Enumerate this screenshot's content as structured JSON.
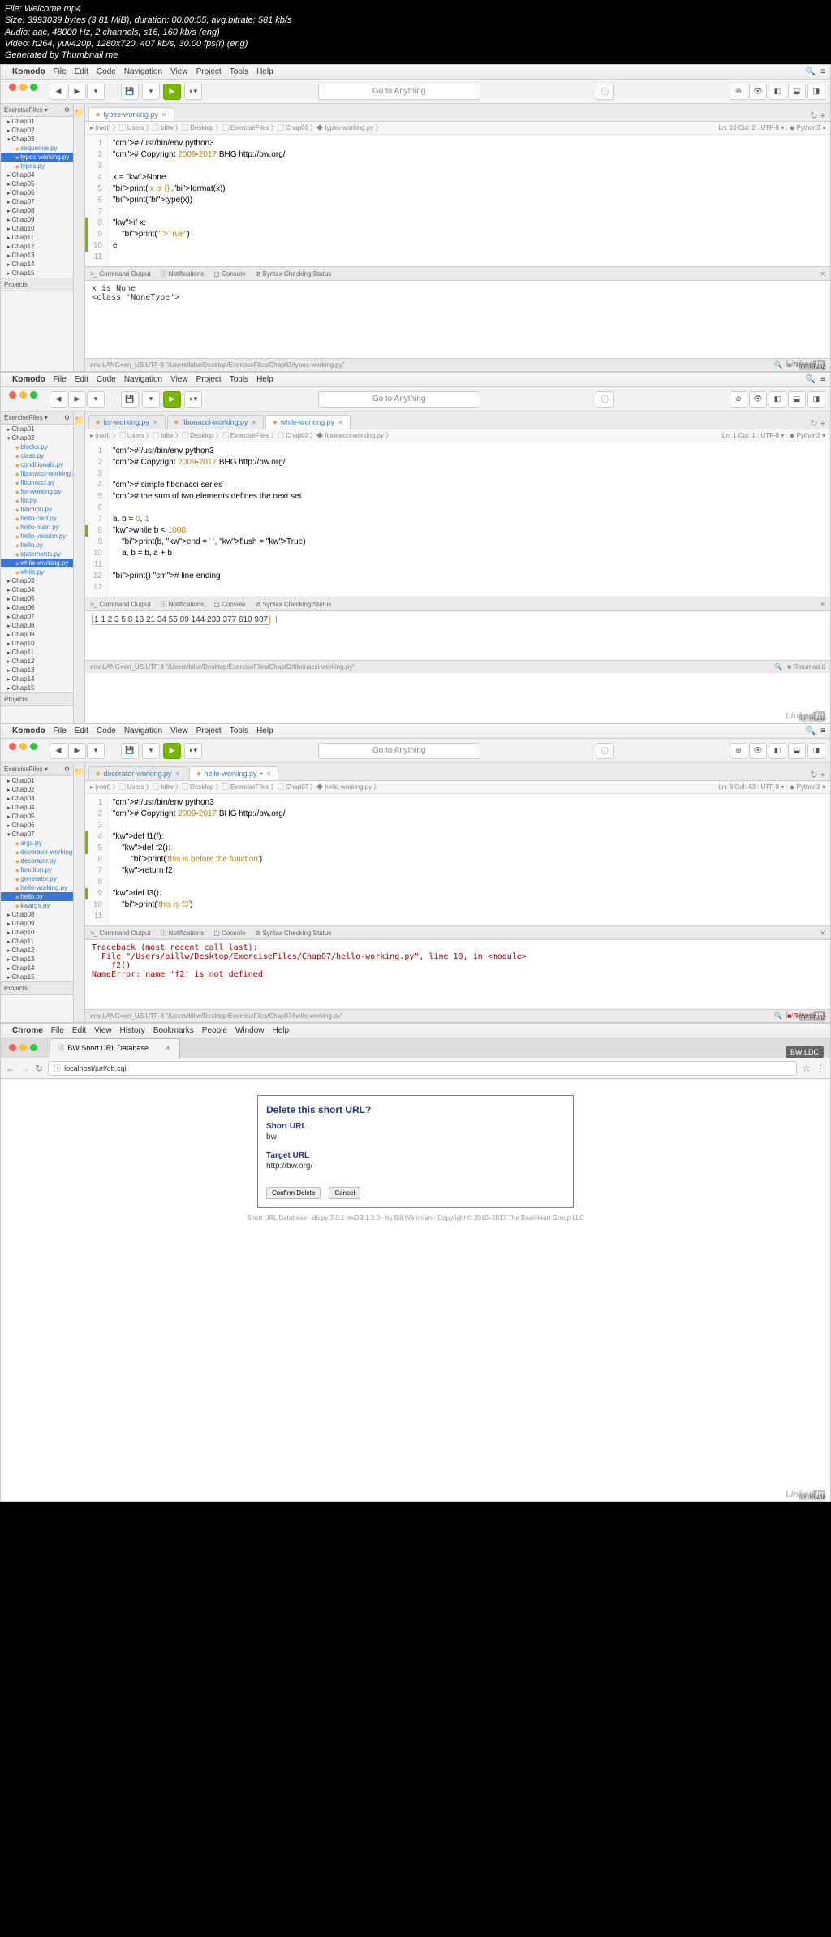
{
  "info_header": {
    "file": "File: Welcome.mp4",
    "size": "Size: 3993039 bytes (3.81 MiB), duration: 00:00:55, avg.bitrate: 581 kb/s",
    "audio": "Audio: aac, 48000 Hz, 2 channels, s16, 160 kb/s (eng)",
    "video": "Video: h264, yuv420p, 1280x720, 407 kb/s, 30.00 fps(r) (eng)",
    "generated": "Generated by Thumbnail me"
  },
  "menubar": {
    "app": "Komodo",
    "items": [
      "File",
      "Edit",
      "Code",
      "Navigation",
      "View",
      "Project",
      "Tools",
      "Help"
    ]
  },
  "goto_placeholder": "Go to Anything",
  "shot1": {
    "sidebar_header": "ExerciseFiles ▾",
    "tree": [
      {
        "t": "folder",
        "l": "Chap01"
      },
      {
        "t": "folder",
        "l": "Chap02"
      },
      {
        "t": "folder open",
        "l": "Chap03"
      },
      {
        "t": "file py",
        "l": "sequence.py"
      },
      {
        "t": "file py selected",
        "l": "types-working.py"
      },
      {
        "t": "file py",
        "l": "types.py"
      },
      {
        "t": "folder",
        "l": "Chap04"
      },
      {
        "t": "folder",
        "l": "Chap05"
      },
      {
        "t": "folder",
        "l": "Chap06"
      },
      {
        "t": "folder",
        "l": "Chap07"
      },
      {
        "t": "folder",
        "l": "Chap08"
      },
      {
        "t": "folder",
        "l": "Chap09"
      },
      {
        "t": "folder",
        "l": "Chap10"
      },
      {
        "t": "folder",
        "l": "Chap11"
      },
      {
        "t": "folder",
        "l": "Chap12"
      },
      {
        "t": "folder",
        "l": "Chap13"
      },
      {
        "t": "folder",
        "l": "Chap14"
      },
      {
        "t": "folder",
        "l": "Chap15"
      }
    ],
    "projects": "Projects",
    "tabs": [
      {
        "label": "types-working.py",
        "active": true
      }
    ],
    "breadcrumb": "▸ (root) 〉▢ Users 〉▢ billw 〉▢ Desktop 〉▢ ExerciseFiles 〉▢ Chap03 〉◆ types-working.py 〉",
    "status_right": "Ln: 10  Col: 2 : UTF-8 ▾ : ◆ Python3 ▾",
    "code_lines": [
      "#!/usr/bin/env python3",
      "# Copyright 2009-2017 BHG http://bw.org/",
      "",
      "x = None",
      "print('x is {}'.format(x))",
      "print(type(x))",
      "",
      "if x:",
      "    print(\"True\")",
      "e",
      ""
    ],
    "panel_tabs": [
      ">_ Command Output",
      "ⓘ Notifications",
      "▢ Console",
      "⊘ Syntax Checking Status"
    ],
    "output": "x is None\n<class 'NoneType'>",
    "statusbar_left": "env LANG=en_US.UTF-8 \"/Users/billw/Desktop/ExerciseFiles/Chap03/types-working.py\"",
    "statusbar_right": "■ Returned 0",
    "timestamp": "00:00:05"
  },
  "shot2": {
    "tree": [
      {
        "t": "folder",
        "l": "Chap01"
      },
      {
        "t": "folder open",
        "l": "Chap02"
      },
      {
        "t": "file py",
        "l": "blocks.py"
      },
      {
        "t": "file py",
        "l": "class.py"
      },
      {
        "t": "file py",
        "l": "conditionals.py"
      },
      {
        "t": "file py",
        "l": "fibonacci-working.py"
      },
      {
        "t": "file py",
        "l": "fibonacci.py"
      },
      {
        "t": "file py",
        "l": "for-working.py"
      },
      {
        "t": "file py",
        "l": "for.py"
      },
      {
        "t": "file py",
        "l": "function.py"
      },
      {
        "t": "file py",
        "l": "hello-cwd.py"
      },
      {
        "t": "file py",
        "l": "hello-main.py"
      },
      {
        "t": "file py",
        "l": "hello-version.py"
      },
      {
        "t": "file py",
        "l": "hello.py"
      },
      {
        "t": "file py",
        "l": "statements.py"
      },
      {
        "t": "file py selected",
        "l": "while-working.py"
      },
      {
        "t": "file py",
        "l": "while.py"
      },
      {
        "t": "folder",
        "l": "Chap03"
      },
      {
        "t": "folder",
        "l": "Chap04"
      },
      {
        "t": "folder",
        "l": "Chap05"
      },
      {
        "t": "folder",
        "l": "Chap06"
      },
      {
        "t": "folder",
        "l": "Chap07"
      },
      {
        "t": "folder",
        "l": "Chap08"
      },
      {
        "t": "folder",
        "l": "Chap09"
      },
      {
        "t": "folder",
        "l": "Chap10"
      },
      {
        "t": "folder",
        "l": "Chap11"
      },
      {
        "t": "folder",
        "l": "Chap12"
      },
      {
        "t": "folder",
        "l": "Chap13"
      },
      {
        "t": "folder",
        "l": "Chap14"
      },
      {
        "t": "folder",
        "l": "Chap15"
      }
    ],
    "tabs": [
      {
        "label": "for-working.py",
        "active": false
      },
      {
        "label": "fibonacci-working.py",
        "active": false
      },
      {
        "label": "while-working.py",
        "active": true
      }
    ],
    "breadcrumb": "▸ (root) 〉▢ Users 〉▢ billw 〉▢ Desktop 〉▢ ExerciseFiles 〉▢ Chap02 〉◆ fibonacci-working.py 〉",
    "status_right": "Ln: 1  Col: 1 : UTF-8 ▾ : ◆ Python3 ▾",
    "code_lines": [
      "#!/usr/bin/env python3",
      "# Copyright 2009-2017 BHG http://bw.org/",
      "",
      "# simple fibonacci series",
      "# the sum of two elements defines the next set",
      "",
      "a, b = 0, 1",
      "while b < 1000:",
      "    print(b, end = ' ', flush = True)",
      "    a, b = b, a + b",
      "",
      "print() # line ending",
      ""
    ],
    "output": "1 1 2 3 5 8 13 21 34 55 89 144 233 377 610 987",
    "statusbar_left": "env LANG=en_US.UTF-8 \"/Users/billw/Desktop/ExerciseFiles/Chap02/fibonacci-working.py\"",
    "statusbar_right": "■ Returned 0",
    "timestamp": "00:00:20"
  },
  "shot3": {
    "tree": [
      {
        "t": "folder",
        "l": "Chap01"
      },
      {
        "t": "folder",
        "l": "Chap02"
      },
      {
        "t": "folder",
        "l": "Chap03"
      },
      {
        "t": "folder",
        "l": "Chap04"
      },
      {
        "t": "folder",
        "l": "Chap05"
      },
      {
        "t": "folder",
        "l": "Chap06"
      },
      {
        "t": "folder open",
        "l": "Chap07"
      },
      {
        "t": "file py",
        "l": "args.py"
      },
      {
        "t": "file py",
        "l": "decorator-working.py"
      },
      {
        "t": "file py",
        "l": "decorator.py"
      },
      {
        "t": "file py",
        "l": "function.py"
      },
      {
        "t": "file py",
        "l": "generator.py"
      },
      {
        "t": "file py",
        "l": "hello-working.py"
      },
      {
        "t": "file py selected",
        "l": "hello.py"
      },
      {
        "t": "file py",
        "l": "kwargs.py"
      },
      {
        "t": "folder",
        "l": "Chap08"
      },
      {
        "t": "folder",
        "l": "Chap09"
      },
      {
        "t": "folder",
        "l": "Chap10"
      },
      {
        "t": "folder",
        "l": "Chap11"
      },
      {
        "t": "folder",
        "l": "Chap12"
      },
      {
        "t": "folder",
        "l": "Chap13"
      },
      {
        "t": "folder",
        "l": "Chap14"
      },
      {
        "t": "folder",
        "l": "Chap15"
      }
    ],
    "tabs": [
      {
        "label": "decorator-working.py",
        "active": false
      },
      {
        "label": "hello-working.py",
        "active": true
      }
    ],
    "breadcrumb": "▸ (root) 〉▢ Users 〉▢ billw 〉▢ Desktop 〉▢ ExerciseFiles 〉▢ Chap07 〉◆ hello-working.py 〉",
    "status_right": "Ln: 8  Col: 43 : UTF-8 ▾ : ◆ Python3 ▾",
    "code_lines": [
      "#!/usr/bin/env python3",
      "# Copyright 2009-2017 BHG http://bw.org/",
      "",
      "def f1(f):",
      "    def f2():",
      "        print('this is before the function')",
      "    return f2",
      "",
      "def f3():",
      "    print('this is f3')",
      ""
    ],
    "output": "Traceback (most recent call last):\n  File \"/Users/billw/Desktop/ExerciseFiles/Chap07/hello-working.py\", line 10, in <module>\n    f2()\nNameError: name 'f2' is not defined",
    "statusbar_left": "env LANG=en_US.UTF-8 \"/Users/billw/Desktop/ExerciseFiles/Chap07/hello-working.py\"",
    "statusbar_right": "■ Returned 1",
    "timestamp": "00:00:35"
  },
  "chrome": {
    "menubar_app": "Chrome",
    "menubar_items": [
      "File",
      "Edit",
      "View",
      "History",
      "Bookmarks",
      "People",
      "Window",
      "Help"
    ],
    "tab_title": "BW Short URL Database",
    "user_badge": "BW LDC",
    "url": "localhost/jurl/db.cgi",
    "form": {
      "title": "Delete this short URL?",
      "label1": "Short URL",
      "val1": "bw",
      "label2": "Target URL",
      "val2": "http://bw.org/",
      "btn1": "Confirm Delete",
      "btn2": "Cancel"
    },
    "footer": "Short URL Database · db.py 2.0.1 bwDB 1.2.0 · by Bill Weinman · Copyright © 2010–2017 The BearHeart Group LLC",
    "timestamp": "00:00:50"
  }
}
